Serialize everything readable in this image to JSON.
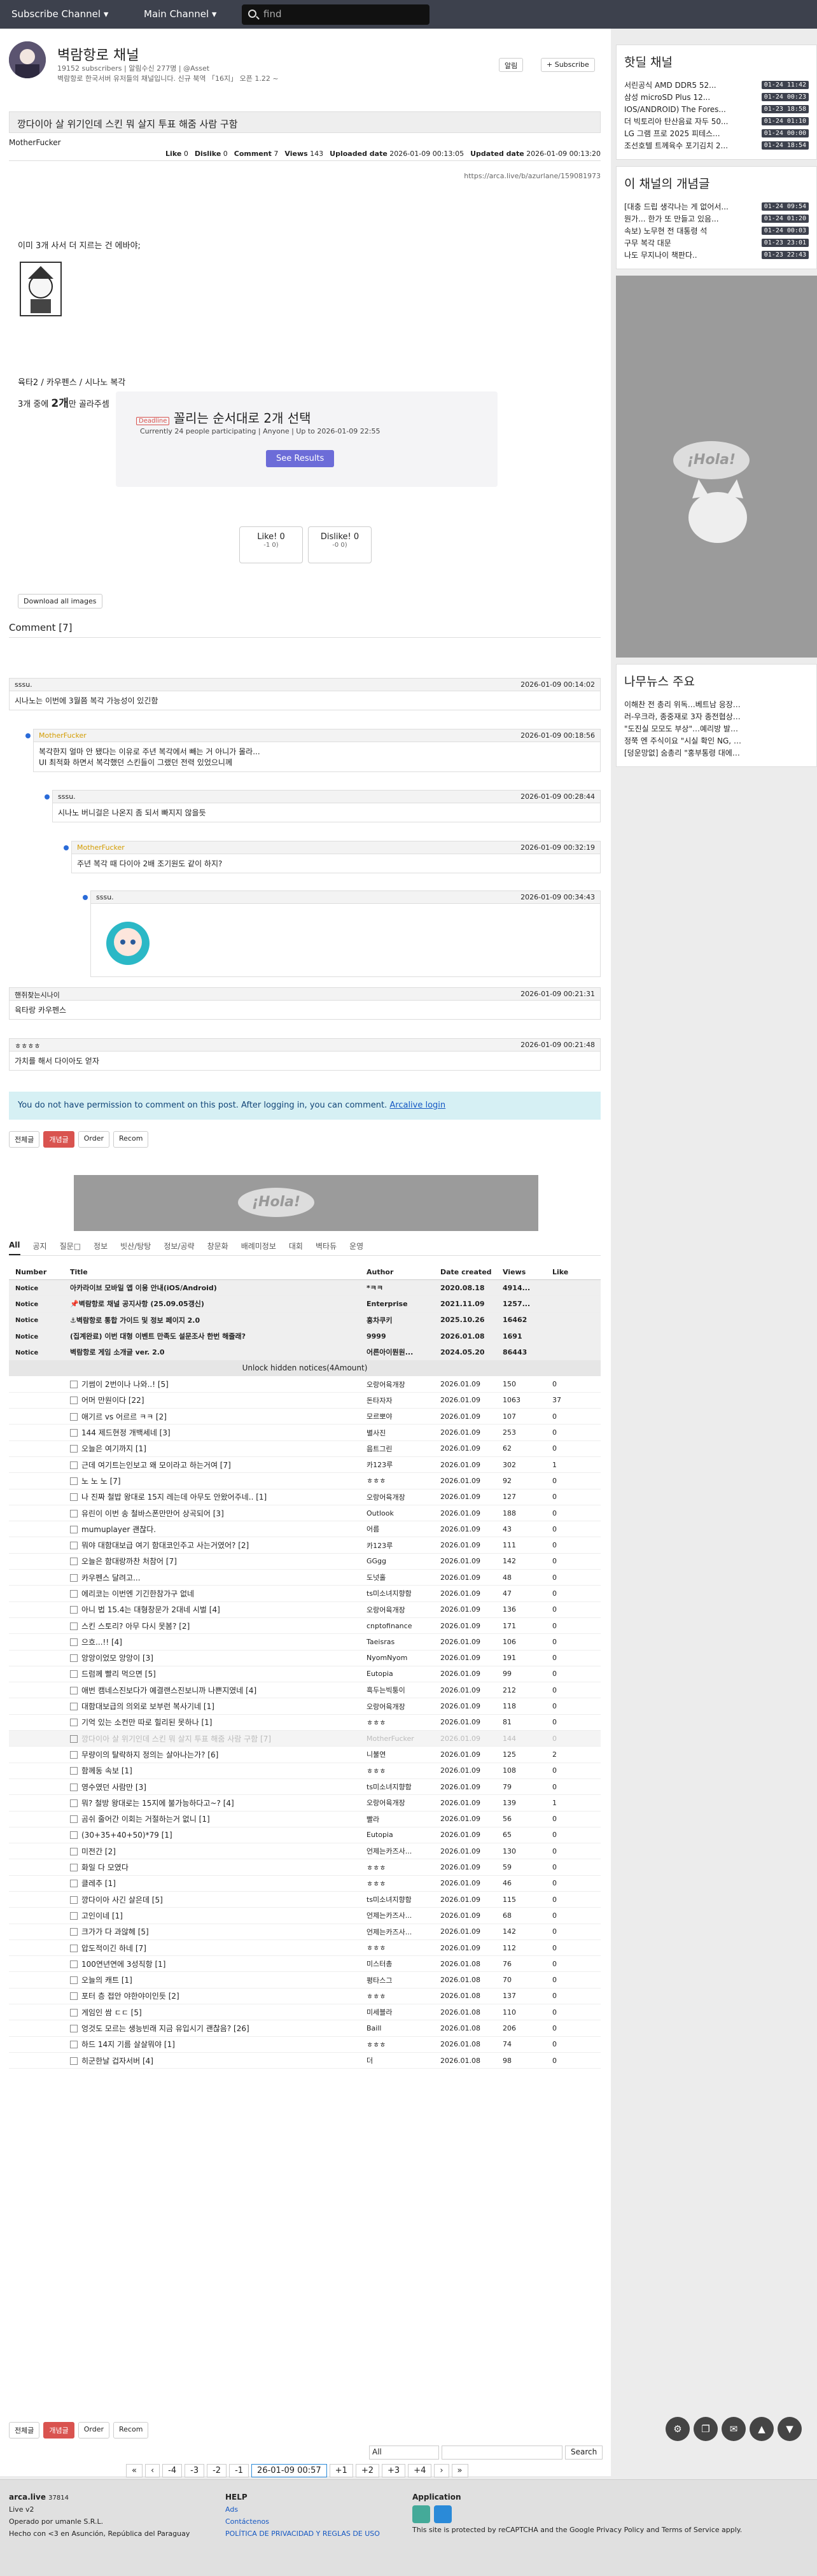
{
  "topbar": {
    "brand": "Subscribe Channel ▾",
    "main": "Main Channel ▾",
    "search_placeholder": "find"
  },
  "channel": {
    "title": "벽람항로 채널",
    "sub": "19152 subscribers | 알림수신 277명 | @Asset",
    "desc": "벽람항로 한국서버 유저들의 채널입니다. 신규 북역 「16지」 오픈 1.22 ~",
    "alarm": "알림",
    "subscribe": "+ Subscribe"
  },
  "post": {
    "title": "깡다이아 살 위기인데 스킨 뭐 살지 투표 해줌 사람 구함",
    "author": "MotherFucker",
    "like_label": "Like",
    "like": "0",
    "dislike_label": "Dislike",
    "dislike": "0",
    "comment_label": "Comment",
    "comment": "7",
    "views_label": "Views",
    "views": "143",
    "up_label": "Uploaded date",
    "uploaded": "2026-01-09 00:13:05",
    "upd_label": "Updated date",
    "updated": "2026-01-09 00:13:20",
    "url": "https://arca.live/b/azurlane/159081973",
    "line1": "이미 3개 사서 더 지르는 건 에바야;",
    "line2": "육타2 / 카우펜스 / 시나노 복각",
    "line3a": "3개 중에 ",
    "line3b": "2개",
    "line3c": "만 골라주셈"
  },
  "vote": {
    "badge": "Deadline",
    "title": "꼴리는 순서대로 2개 선택",
    "info": "Currently 24 people participating | Anyone | Up to 2026-01-09 22:55",
    "btn": "See Results"
  },
  "likebtn": {
    "like": "Like! 0",
    "like_sub": "-1 0)",
    "dislike": "Dislike! 0",
    "dislike_sub": "-0 0)"
  },
  "download": "Download all images",
  "comments_header": "Comment [7]",
  "comments": [
    {
      "user": "sssu.",
      "time": "2026-01-09 00:14:02",
      "text": "시나노는 이번에 3월쯤 복각 가능성이 있긴함"
    },
    {
      "user": "MotherFucker",
      "time": "2026-01-09 00:18:56",
      "text": "복각한지 얼마 안 됐다는 이유로 주년 복각에서 빼는 거 아니가 몰라...",
      "text2": "UI 최적화 하면서 복각했던 스킨들이 그랬던 전력 있었으니께"
    },
    {
      "user": "sssu.",
      "time": "2026-01-09 00:28:44",
      "text": "시나노 버니걸은 나온지 좀 되서 빠지지 않을듯"
    },
    {
      "user": "MotherFucker",
      "time": "2026-01-09 00:32:19",
      "text": "주년 복각 때 다이아 2배 조기원도 같이 하지?"
    },
    {
      "user": "sssu.",
      "time": "2026-01-09 00:34:43",
      "text": ""
    },
    {
      "user": "핸쥐찾는시나이",
      "time": "2026-01-09 00:21:31",
      "text": "육타랑 카우펜스"
    },
    {
      "user": "ㅎㅎㅎㅎ",
      "time": "2026-01-09 00:21:48",
      "text": "가치를 해서 다이아도 얻자"
    }
  ],
  "notice_msg": "You do not have permission to comment on this post. After logging in, you can comment.",
  "notice_link": "Arcalive login",
  "tools": {
    "all": "전체글",
    "best": "개념글",
    "order": "Order",
    "recom": "Recom"
  },
  "categories": [
    "All",
    "공지",
    "질문□",
    "정보",
    "빗산/탕탕",
    "정보/공략",
    "창문화",
    "배례미정보",
    "대회",
    "벽타듀",
    "운영"
  ],
  "list_head": [
    "Number",
    "Title",
    "Author",
    "Date created",
    "Views",
    "Like"
  ],
  "notices": [
    {
      "title": "아카라이브 모바일 앱 이용 안내(iOS/Android)",
      "author": "*ㅋㅋ",
      "date": "2020.08.18",
      "views": "4914...",
      "like": ""
    },
    {
      "title": "📌벽람항로 채널 공지사항 (25.09.05갱신)",
      "author": "Enterprise",
      "date": "2021.11.09",
      "views": "1257...",
      "like": ""
    },
    {
      "title": "⚓벽람항로 통합 가이드 및 정보 페이지 2.0",
      "author": "홍차쿠키",
      "date": "2025.10.26",
      "views": "16462",
      "like": ""
    },
    {
      "title": "(집계완료) 이번 대형 이벤트 만족도 설문조사 한번 해줄래?",
      "author": "9999",
      "date": "2026.01.08",
      "views": "1691",
      "like": ""
    },
    {
      "title": "벽람항로 게임 소개글 ver. 2.0",
      "author": "어른아이뭔원...",
      "date": "2024.05.20",
      "views": "86443",
      "like": ""
    }
  ],
  "unhide": "Unlock hidden notices(4Amount)",
  "rows": [
    {
      "t": "기썸이 2번이나 나와..! [5]",
      "a": "오랑어육개장",
      "d": "2026.01.09",
      "v": "150",
      "l": "0"
    },
    {
      "t": "어머 만원이다 [22]",
      "a": "돈타자자",
      "d": "2026.01.09",
      "v": "1063",
      "l": "37"
    },
    {
      "t": "애기르 vs 어르르 ㅋㅋ [2]",
      "a": "모르뽀야",
      "d": "2026.01.09",
      "v": "107",
      "l": "0"
    },
    {
      "t": "144 제드현정 개백세네 [3]",
      "a": "별사진",
      "d": "2026.01.09",
      "v": "253",
      "l": "0"
    },
    {
      "t": "오늘은 여기까지 [1]",
      "a": "음트그린",
      "d": "2026.01.09",
      "v": "62",
      "l": "0"
    },
    {
      "t": "근데 여기트는인보고 왜 모이라고 하는거여 [7]",
      "a": "카123루",
      "d": "2026.01.09",
      "v": "302",
      "l": "1"
    },
    {
      "t": "노 노 노 [7]",
      "a": "ㅎㅎㅎ",
      "d": "2026.01.09",
      "v": "92",
      "l": "0"
    },
    {
      "t": "나 진짜 철밥 왕대로 15지 레는데 아무도 안왔어주네.. [1]",
      "a": "오랑어육개장",
      "d": "2026.01.09",
      "v": "127",
      "l": "0"
    },
    {
      "t": "유린이 이번 송 철바스폰만만어 상곡되어 [3]",
      "a": "Outlook",
      "d": "2026.01.09",
      "v": "188",
      "l": "0"
    },
    {
      "t": "mumuplayer 괜찮다.",
      "a": "어름",
      "d": "2026.01.09",
      "v": "43",
      "l": "0"
    },
    {
      "t": "뭐야 대함대보급 여기 함대코인주고 사는거였어? [2]",
      "a": "카123루",
      "d": "2026.01.09",
      "v": "111",
      "l": "0"
    },
    {
      "t": "오늘은 함대랑까찬 처참어 [7]",
      "a": "GGgg",
      "d": "2026.01.09",
      "v": "142",
      "l": "0"
    },
    {
      "t": "카우펜스 달려고...",
      "a": "도넛홀",
      "d": "2026.01.09",
      "v": "48",
      "l": "0"
    },
    {
      "t": "에리코는 이번엔 기긴한참가구 없네",
      "a": "ts미소녀지향함",
      "d": "2026.01.09",
      "v": "47",
      "l": "0"
    },
    {
      "t": "아니 법 15.4는 대형창문가 2대네 시벌 [4]",
      "a": "오랑어육개장",
      "d": "2026.01.09",
      "v": "136",
      "l": "0"
    },
    {
      "t": "스킨 스토리? 아무 다시 못봄? [2]",
      "a": "cnptofinance",
      "d": "2026.01.09",
      "v": "171",
      "l": "0"
    },
    {
      "t": "으흐...!! [4]",
      "a": "Taeisras",
      "d": "2026.01.09",
      "v": "106",
      "l": "0"
    },
    {
      "t": "앙앙이었모 앙앙이 [3]",
      "a": "NyomNyom",
      "d": "2026.01.09",
      "v": "191",
      "l": "0"
    },
    {
      "t": "드럼께 빨리 먹으면 [5]",
      "a": "Eutopia",
      "d": "2026.01.09",
      "v": "99",
      "l": "0"
    },
    {
      "t": "애번 캠네스진보다가 예결랜스진보니까 나쁜지였네 [4]",
      "a": "흑두는빅퉁이",
      "d": "2026.01.09",
      "v": "212",
      "l": "0"
    },
    {
      "t": "대함대보급의 의외로 보부런 복사기네 [1]",
      "a": "오랑어육개장",
      "d": "2026.01.09",
      "v": "118",
      "l": "0"
    },
    {
      "t": "기억 있는 소컨만 따로 힐리된 못하나 [1]",
      "a": "ㅎㅎㅎ",
      "d": "2026.01.09",
      "v": "81",
      "l": "0"
    },
    {
      "t": "깡다이아 살 위기인데 스킨 뭐 살지 투표 해줌 사람 구함 [7]",
      "a": "MotherFucker",
      "d": "2026.01.09",
      "v": "144",
      "l": "0",
      "grey": true
    },
    {
      "t": "무량이의 탈락하지 정의는 살아나는가? [6]",
      "a": "니불연",
      "d": "2026.01.09",
      "v": "125",
      "l": "2"
    },
    {
      "t": "함께동 속보 [1]",
      "a": "ㅎㅎㅎ",
      "d": "2026.01.09",
      "v": "108",
      "l": "0"
    },
    {
      "t": "영수였던 사람만 [3]",
      "a": "ts미소녀지향함",
      "d": "2026.01.09",
      "v": "79",
      "l": "0"
    },
    {
      "t": "뭐? 철방 왕대로는 15지에 불가능하다고~? [4]",
      "a": "오랑어육개장",
      "d": "2026.01.09",
      "v": "139",
      "l": "1"
    },
    {
      "t": "곰쉬 줄어간 이회는 거절하는거 없니 [1]",
      "a": "빨라",
      "d": "2026.01.09",
      "v": "56",
      "l": "0"
    },
    {
      "t": "(30+35+40+50)*79 [1]",
      "a": "Eutopia",
      "d": "2026.01.09",
      "v": "65",
      "l": "0"
    },
    {
      "t": "미전간 [2]",
      "a": "언제는카즈사...",
      "d": "2026.01.09",
      "v": "130",
      "l": "0"
    },
    {
      "t": "화일 다 모였다",
      "a": "ㅎㅎㅎ",
      "d": "2026.01.09",
      "v": "59",
      "l": "0"
    },
    {
      "t": "클레추 [1]",
      "a": "ㅎㅎㅎ",
      "d": "2026.01.09",
      "v": "46",
      "l": "0"
    },
    {
      "t": "깡다이아 사긴 살은데 [5]",
      "a": "ts미소녀지향함",
      "d": "2026.01.09",
      "v": "115",
      "l": "0"
    },
    {
      "t": "고인이네 [1]",
      "a": "언제는카즈사...",
      "d": "2026.01.09",
      "v": "68",
      "l": "0"
    },
    {
      "t": "크가가 다 과않헤 [5]",
      "a": "언제는카즈사...",
      "d": "2026.01.09",
      "v": "142",
      "l": "0"
    },
    {
      "t": "압도적이긴 하네 [7]",
      "a": "ㅎㅎㅎ",
      "d": "2026.01.09",
      "v": "112",
      "l": "0"
    },
    {
      "t": "100연년연에 3성직항 [1]",
      "a": "미스터총",
      "d": "2026.01.08",
      "v": "76",
      "l": "0"
    },
    {
      "t": "오늘의 캐트 [1]",
      "a": "평타스그",
      "d": "2026.01.08",
      "v": "70",
      "l": "0"
    },
    {
      "t": "포터 층 접안 야한야이인듯 [2]",
      "a": "ㅎㅎㅎ",
      "d": "2026.01.08",
      "v": "137",
      "l": "0"
    },
    {
      "t": "게임인 쌈 ㄷㄷ [5]",
      "a": "미세블라",
      "d": "2026.01.08",
      "v": "110",
      "l": "0"
    },
    {
      "t": "엉것도 모르는 생능빈래 지금 유입시기 괜찮음? [26]",
      "a": "Baill",
      "d": "2026.01.08",
      "v": "206",
      "l": "0"
    },
    {
      "t": "하드 14지 기름 살살뭐야 [1]",
      "a": "ㅎㅎㅎ",
      "d": "2026.01.08",
      "v": "74",
      "l": "0"
    },
    {
      "t": "히군한날 겁자서버 [4]",
      "a": "더",
      "d": "2026.01.08",
      "v": "98",
      "l": "0"
    }
  ],
  "pager": [
    "«",
    "‹",
    "-4",
    "-3",
    "-2",
    "-1",
    "26-01-09 00:57",
    "+1",
    "+2",
    "+3",
    "+4",
    "›",
    "»"
  ],
  "search": {
    "select": "All",
    "btn": "Search"
  },
  "side": {
    "hot_title": "핫딜 채널",
    "hot": [
      [
        "서린공식 AMD DDR5 52...",
        "01-24 11:42"
      ],
      [
        "삼성 microSD Plus 12...",
        "01-24 00:23"
      ],
      [
        "IOS/ANDROID) The Fores...",
        "01-23 18:58"
      ],
      [
        "더 빅토리아 탄산음료 자두 50...",
        "01-24 01:10"
      ],
      [
        "LG 그램 프로 2025 피테스...",
        "01-24 00:00"
      ],
      [
        "조선호텔 트께육수 포기김치 2...",
        "01-24 18:54"
      ]
    ],
    "best_title": "이 채널의 개념글",
    "best": [
      [
        "[대충 드립 생각나는 게 없어서...",
        "01-24 09:54"
      ],
      [
        "뭔가... 한가 또 만들고 있음...",
        "01-24 01:20"
      ],
      [
        "속보) 노무현 전 대통령 석",
        "01-24 00:03"
      ],
      [
        "구무 복각 대문",
        "01-23 23:01"
      ],
      [
        "나도 무지나이 책판다..",
        "01-23 22:43"
      ]
    ],
    "news_title": "나무뉴스 주요",
    "news": [
      "이해찬 전 총리 위독…베트남 응장중 심근괴...",
      "러-우크라, 종중재로 3자 종전협상…첫날 진...",
      "\"도진실 모모도 부상\"…예리방 발목 수술 3...",
      "정쭉 엔 주식이요 \"시실 확인 NG, 전국민 가...",
      "[덩운망없] 숨총리 \"홍부통령 대에관계 조연..."
    ]
  },
  "footer": {
    "brand": "arca.live",
    "brand_num": "37814",
    "ver": "Live v2",
    "operado": "Operado por umanle S.R.L.",
    "hecho": "Hecho con <3 en Asunción, República del Paraguay",
    "help": "HELP",
    "ads": "Ads",
    "contact": "Contáctenos",
    "policy": "POLÍTICA DE PRIVACIDAD Y REGLAS DE USO",
    "app": "Application",
    "recaptcha": "This site is protected by reCAPTCHA and the Google Privacy Policy and Terms of Service apply."
  }
}
